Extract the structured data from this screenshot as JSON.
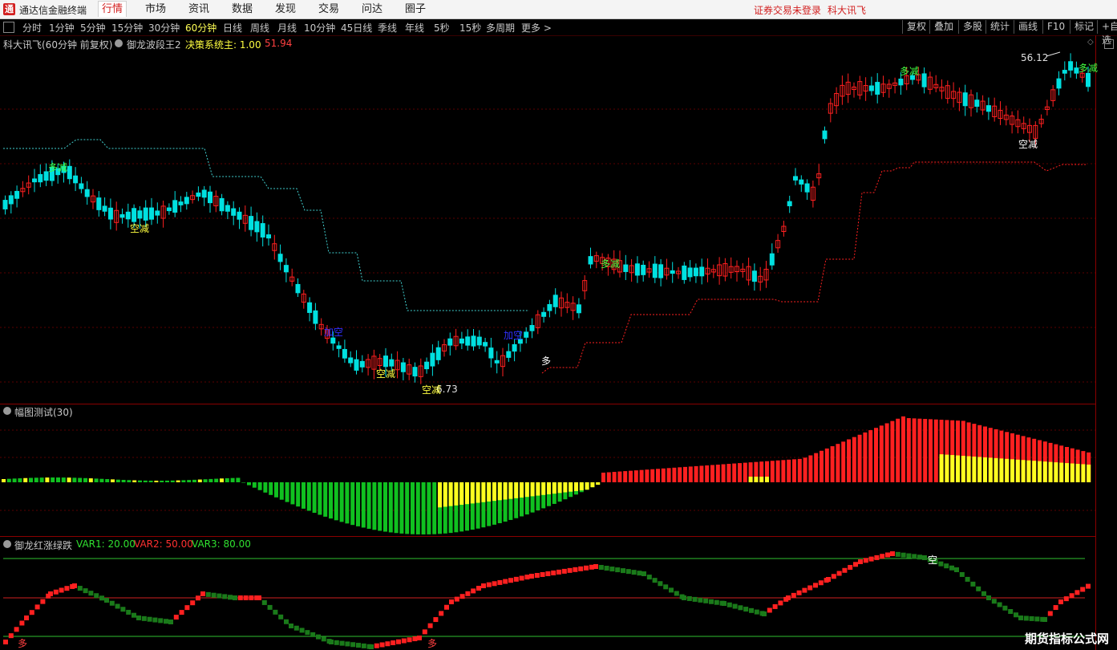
{
  "app": {
    "logo_char": "通",
    "title": "通达信金融终端",
    "menu": [
      "行情",
      "市场",
      "资讯",
      "数据",
      "发现",
      "交易",
      "问达",
      "圈子"
    ],
    "status_login": "证券交易未登录",
    "status_user": "科大讯飞"
  },
  "toolbar": {
    "periods": [
      "分时",
      "1分钟",
      "5分钟",
      "15分钟",
      "30分钟",
      "60分钟",
      "日线",
      "周线",
      "月线",
      "10分钟",
      "45日线",
      "季线",
      "年线",
      "5秒",
      "15秒",
      "多周期",
      "更多 >"
    ],
    "active_period": "60分钟",
    "right_buttons": [
      "复权",
      "叠加",
      "多股",
      "统计",
      "画线",
      "F10",
      "标记",
      "+自选"
    ]
  },
  "main_panel": {
    "stock": "科大讯飞(60分钟 前复权)",
    "indicator": "御龙波段王2",
    "value_label": "决策系统主: 1.00",
    "value2": "51.94",
    "high_label": "56.12",
    "low_label": "6.73",
    "annotations": [
      "多减",
      "空减",
      "空减",
      "加空",
      "加空",
      "空减",
      "多",
      "多减",
      "多减",
      "空减"
    ]
  },
  "width_panel": {
    "title": "幅图测试(30)"
  },
  "bottom_panel": {
    "title": "御龙红涨绿跌",
    "var1": "VAR1: 20.00",
    "var2": "VAR2: 50.00",
    "var3": "VAR3: 80.00",
    "annotations": [
      "多",
      "多",
      "空"
    ]
  },
  "watermark": "期货指标公式网",
  "colors": {
    "up": "#ff2020",
    "down": "#00e0e0",
    "green": "#10c020",
    "yellow": "#ffff20",
    "dark_green": "#1a7a1a"
  }
}
